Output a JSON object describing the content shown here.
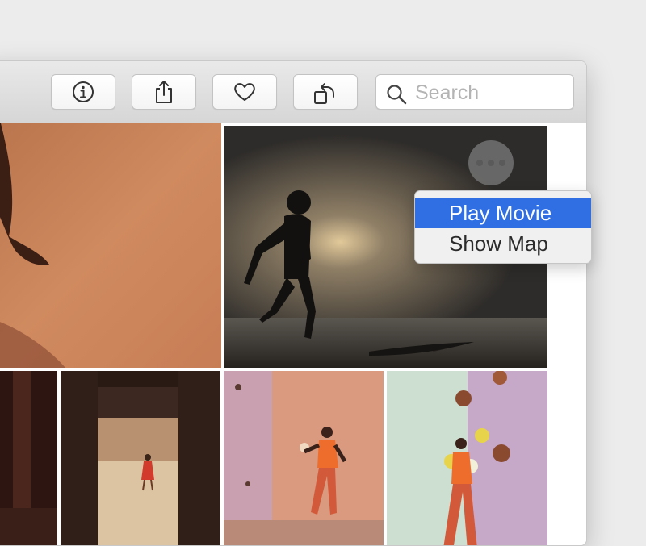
{
  "toolbar": {
    "buttons": [
      {
        "icon": "info-icon"
      },
      {
        "icon": "share-icon"
      },
      {
        "icon": "heart-icon"
      },
      {
        "icon": "rotate-icon"
      }
    ],
    "search": {
      "placeholder": "Search",
      "value": ""
    }
  },
  "photos": [
    {
      "subject": "hand against orange wall"
    },
    {
      "subject": "silhouette running on beach at sunset"
    },
    {
      "subject": "dark doorway interior"
    },
    {
      "subject": "child in red dress seen through doorway"
    },
    {
      "subject": "juggler with ball against pink wall"
    },
    {
      "subject": "juggler with many balls against green and pink wall"
    }
  ],
  "more_button": {
    "icon": "more-icon"
  },
  "context_menu": {
    "items": [
      {
        "label": "Play Movie",
        "selected": true
      },
      {
        "label": "Show Map",
        "selected": false
      }
    ]
  },
  "colors": {
    "selection": "#2f6fe3",
    "toolbar": "#dddddd",
    "background": "#ececec"
  }
}
